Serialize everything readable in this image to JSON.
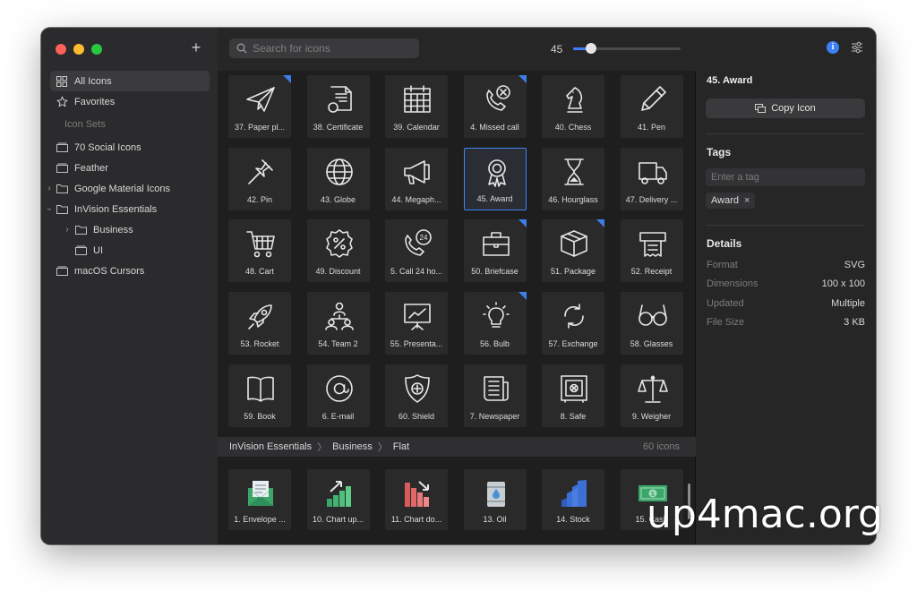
{
  "sidebar": {
    "add_label": "+",
    "all_icons": "All Icons",
    "favorites": "Favorites",
    "section_label": "Icon Sets",
    "sets": [
      "70 Social Icons",
      "Feather",
      "Google Material Icons",
      "InVision Essentials",
      "Business",
      "UI",
      "macOS Cursors"
    ]
  },
  "toolbar": {
    "search_placeholder": "Search for icons",
    "size_value": "45",
    "size_fraction": 0.17
  },
  "icons": [
    {
      "label": "37. Paper pl...",
      "icon": "paper-plane-icon",
      "fav": true
    },
    {
      "label": "38. Certificate",
      "icon": "certificate-icon",
      "fav": false
    },
    {
      "label": "39. Calendar",
      "icon": "calendar-icon",
      "fav": false
    },
    {
      "label": "4. Missed call",
      "icon": "missed-call-icon",
      "fav": true
    },
    {
      "label": "40. Chess",
      "icon": "chess-icon",
      "fav": false
    },
    {
      "label": "41. Pen",
      "icon": "pen-icon",
      "fav": false
    },
    {
      "label": "42. Pin",
      "icon": "pin-icon",
      "fav": false
    },
    {
      "label": "43. Globe",
      "icon": "globe-icon",
      "fav": false
    },
    {
      "label": "44. Megaph...",
      "icon": "megaphone-icon",
      "fav": false
    },
    {
      "label": "45. Award",
      "icon": "award-icon",
      "fav": false,
      "selected": true
    },
    {
      "label": "46. Hourglass",
      "icon": "hourglass-icon",
      "fav": false
    },
    {
      "label": "47. Delivery ...",
      "icon": "delivery-truck-icon",
      "fav": false
    },
    {
      "label": "48. Cart",
      "icon": "cart-icon",
      "fav": false
    },
    {
      "label": "49. Discount",
      "icon": "discount-icon",
      "fav": false
    },
    {
      "label": "5. Call 24 ho...",
      "icon": "call-24-icon",
      "fav": false
    },
    {
      "label": "50. Briefcase",
      "icon": "briefcase-icon",
      "fav": true
    },
    {
      "label": "51. Package",
      "icon": "package-icon",
      "fav": true
    },
    {
      "label": "52. Receipt",
      "icon": "receipt-icon",
      "fav": false
    },
    {
      "label": "53. Rocket",
      "icon": "rocket-icon",
      "fav": false
    },
    {
      "label": "54. Team 2",
      "icon": "team-icon",
      "fav": false
    },
    {
      "label": "55. Presenta...",
      "icon": "presentation-icon",
      "fav": false
    },
    {
      "label": "56. Bulb",
      "icon": "bulb-icon",
      "fav": true
    },
    {
      "label": "57. Exchange",
      "icon": "exchange-icon",
      "fav": false
    },
    {
      "label": "58. Glasses",
      "icon": "glasses-icon",
      "fav": false
    },
    {
      "label": "59. Book",
      "icon": "book-icon",
      "fav": false
    },
    {
      "label": "6. E-mail",
      "icon": "email-icon",
      "fav": false
    },
    {
      "label": "60. Shield",
      "icon": "shield-icon",
      "fav": false
    },
    {
      "label": "7. Newspaper",
      "icon": "newspaper-icon",
      "fav": false
    },
    {
      "label": "8. Safe",
      "icon": "safe-icon",
      "fav": false
    },
    {
      "label": "9. Weigher",
      "icon": "weigher-icon",
      "fav": false
    }
  ],
  "path": {
    "crumbs": [
      "InVision Essentials",
      "Business",
      "Flat"
    ],
    "count": "60 icons"
  },
  "flat_icons": [
    {
      "label": "1. Envelope ...",
      "icon": "envelope-icon"
    },
    {
      "label": "10. Chart up...",
      "icon": "chart-up-icon"
    },
    {
      "label": "11. Chart do...",
      "icon": "chart-down-icon"
    },
    {
      "label": "13. Oil",
      "icon": "oil-icon"
    },
    {
      "label": "14. Stock",
      "icon": "stock-icon"
    },
    {
      "label": "15. Cash",
      "icon": "cash-icon"
    }
  ],
  "inspector": {
    "title": "45. Award",
    "copy_label": "Copy Icon",
    "tags_heading": "Tags",
    "tag_placeholder": "Enter a tag",
    "tags": [
      "Award"
    ],
    "details_heading": "Details",
    "details": [
      {
        "key": "Format",
        "value": "SVG"
      },
      {
        "key": "Dimensions",
        "value": "100 x 100"
      },
      {
        "key": "Updated",
        "value": "Multiple"
      },
      {
        "key": "File Size",
        "value": "3 KB"
      }
    ]
  },
  "watermark": "up4mac.org",
  "colors": {
    "accent": "#3e7ff6",
    "selection": "#3e83f5"
  }
}
